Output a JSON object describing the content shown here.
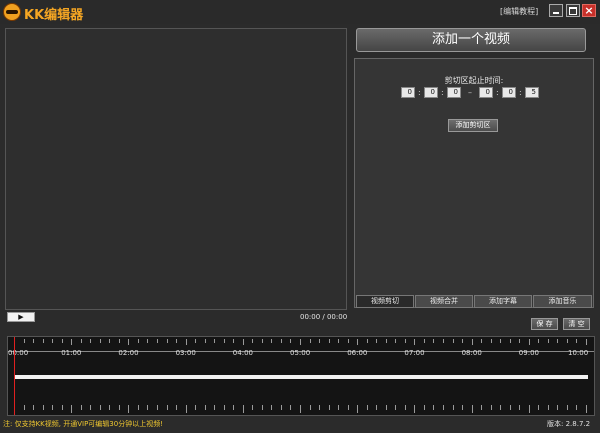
{
  "app": {
    "title": "KK编辑器",
    "tutorial_link": "[编辑教程]"
  },
  "window_controls": {
    "minimize": "minimize-icon",
    "maximize": "maximize-icon",
    "close": "close-icon",
    "close_glyph": "×"
  },
  "player": {
    "play_glyph": "▶",
    "time": "00:00 / 00:00"
  },
  "right_panel": {
    "add_video_label": "添加一个视频",
    "clip_time_label": "剪切区起止时间:",
    "start_time": [
      "0",
      "0",
      "0"
    ],
    "end_time": [
      "0",
      "0",
      "5"
    ],
    "colon": ":",
    "dash": "–",
    "add_clip_label": "添加剪切区",
    "tabs": [
      "视频剪切",
      "视频合并",
      "添加字幕",
      "添加音乐"
    ],
    "active_tab": "视频剪切"
  },
  "actions": {
    "save_label": "保 存",
    "clear_label": "清 空"
  },
  "timeline": {
    "labels": [
      "00:00",
      "01:00",
      "02:00",
      "03:00",
      "04:00",
      "05:00",
      "06:00",
      "07:00",
      "08:00",
      "09:00",
      "10:00"
    ]
  },
  "status": {
    "note": "注: 仅支持KK视频, 开通VIP可编辑30分钟以上视频!",
    "version": "版本: 2.8.7.2"
  },
  "colors": {
    "accent": "#f5a623",
    "close": "#c8302a",
    "playhead": "#e02020",
    "note_text": "#f0c830"
  }
}
